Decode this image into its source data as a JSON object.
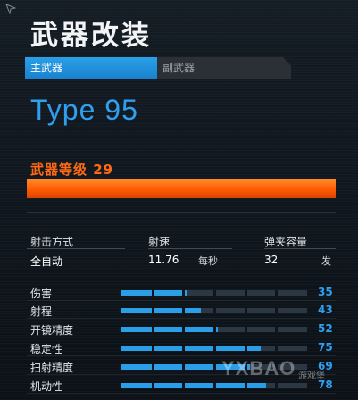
{
  "header": {
    "title": "武器改装"
  },
  "tabs": {
    "primary_label": "主武器",
    "secondary_label": "副武器"
  },
  "weapon": {
    "name": "Type 95",
    "level_label": "武器等级 29",
    "level_progress": 1.0
  },
  "stats": {
    "fire_mode_label": "射击方式",
    "fire_mode_value": "全自动",
    "rate_label": "射速",
    "rate_value": "11.76",
    "rate_unit": "每秒",
    "magazine_label": "弹夹容量",
    "magazine_value": "32",
    "magazine_unit": "发"
  },
  "attributes": [
    {
      "label": "伤害",
      "value": "35",
      "level": 0.35
    },
    {
      "label": "射程",
      "value": "43",
      "level": 0.43
    },
    {
      "label": "开镜精度",
      "value": "52",
      "level": 0.52
    },
    {
      "label": "稳定性",
      "value": "75",
      "level": 0.75
    },
    {
      "label": "扫射精度",
      "value": "69",
      "level": 0.69
    },
    {
      "label": "机动性",
      "value": "78",
      "level": 0.78
    }
  ],
  "watermark": {
    "text": "YXBAO",
    "sub": "游戏堡"
  },
  "colors": {
    "accent_blue": "#2a9fe8",
    "accent_orange": "#ff5a00"
  },
  "icons": {
    "corner": "arrow-cursor-icon"
  }
}
